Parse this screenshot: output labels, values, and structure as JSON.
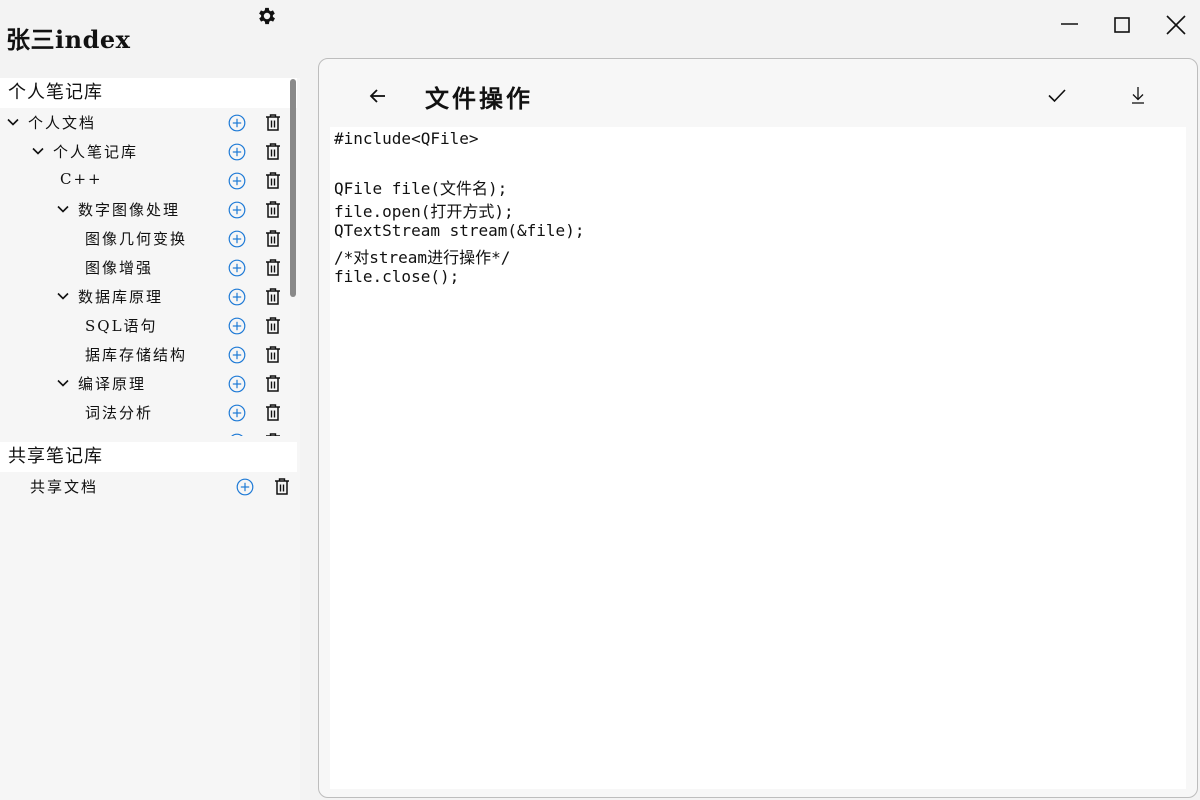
{
  "window": {
    "title": "张三index"
  },
  "sidebar": {
    "personal_header": "个人笔记库",
    "tree": [
      {
        "label": "个人文档",
        "expanded": true
      },
      {
        "label": "个人笔记库",
        "expanded": true
      },
      {
        "label": "C++",
        "expanded": null
      },
      {
        "label": "数字图像处理",
        "expanded": true
      },
      {
        "label": "图像几何变换",
        "expanded": null
      },
      {
        "label": "图像增强",
        "expanded": null
      },
      {
        "label": "数据库原理",
        "expanded": true
      },
      {
        "label": "SQL语句",
        "expanded": null
      },
      {
        "label": "据库存储结构",
        "expanded": null
      },
      {
        "label": "编译原理",
        "expanded": true
      },
      {
        "label": "词法分析",
        "expanded": null
      }
    ],
    "shared_header": "共享笔记库",
    "shared_tree": [
      {
        "label": "共享文档"
      }
    ]
  },
  "editor": {
    "title": "文件操作",
    "lines": [
      "#include<QFile>",
      "",
      "QFile file(文件名);",
      "file.open(打开方式);",
      "QTextStream stream(&file);",
      "/*对stream进行操作*/",
      "file.close();"
    ]
  },
  "icons": {
    "settings": "gear-icon",
    "minimize": "minimize-icon",
    "maximize": "maximize-icon",
    "close": "close-icon",
    "back": "arrow-left-icon",
    "save": "check-icon",
    "download": "download-icon",
    "add": "plus-circle-icon",
    "delete": "trash-icon",
    "expand": "chevron-down-icon"
  },
  "colors": {
    "accent": "#1e7ad6",
    "background": "#f3f3f3",
    "editor_bg": "#ffffff",
    "scrollbar": "#8a8a8a"
  }
}
